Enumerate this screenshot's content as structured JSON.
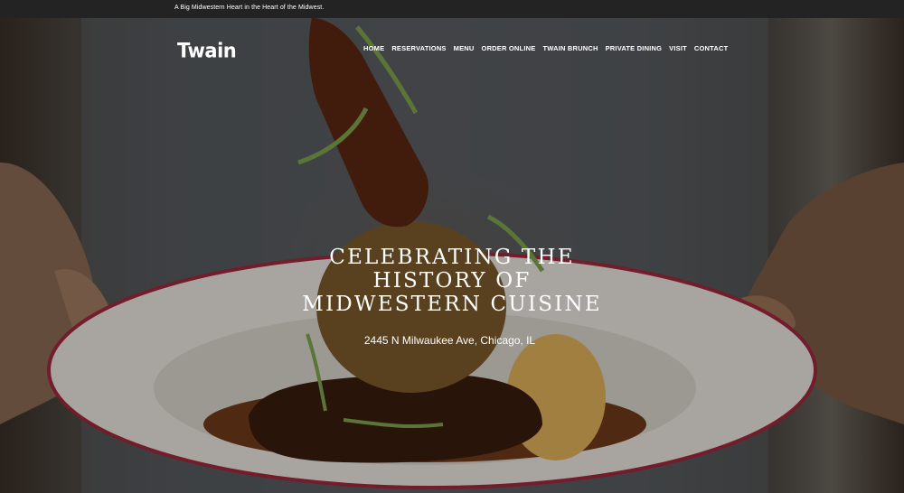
{
  "topbar": {
    "tagline": "A Big Midwestern Heart in the Heart of the Midwest."
  },
  "header": {
    "logo_text": "Twain",
    "nav": [
      {
        "label": "HOME"
      },
      {
        "label": "RESERVATIONS"
      },
      {
        "label": "MENU"
      },
      {
        "label": "ORDER ONLINE"
      },
      {
        "label": "TWAIN BRUNCH"
      },
      {
        "label": "PRIVATE DINING"
      },
      {
        "label": "VISIT"
      },
      {
        "label": "CONTACT"
      }
    ]
  },
  "hero": {
    "headline_lines": [
      "CELEBRATING THE",
      "HISTORY OF",
      "MIDWESTERN CUISINE"
    ],
    "address": "2445 N Milwaukee Ave, Chicago, IL",
    "image_icon": "plated-dish-photo"
  },
  "colors": {
    "topbar_bg": "#232323",
    "text": "#ffffff",
    "plate_rim": "#a0283c"
  }
}
